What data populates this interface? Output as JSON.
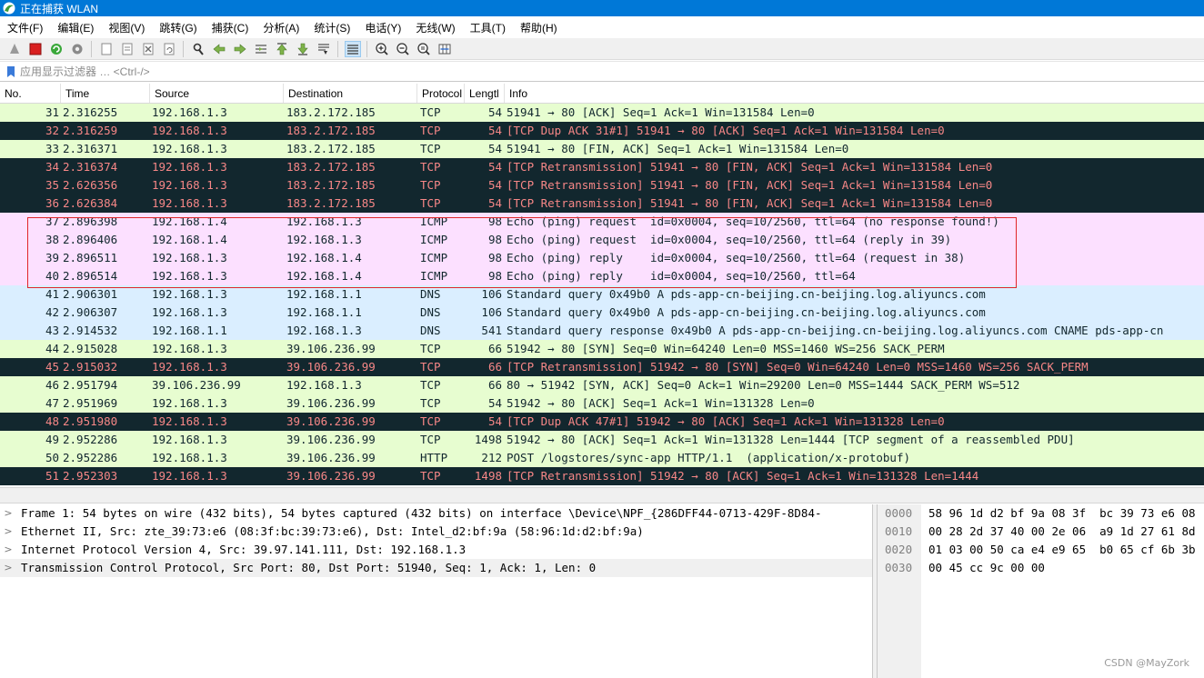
{
  "window": {
    "title": "正在捕获 WLAN"
  },
  "menu": [
    "文件(F)",
    "编辑(E)",
    "视图(V)",
    "跳转(G)",
    "捕获(C)",
    "分析(A)",
    "统计(S)",
    "电话(Y)",
    "无线(W)",
    "工具(T)",
    "帮助(H)"
  ],
  "toolbar_icons": [
    "start-capture-icon",
    "stop-capture-icon",
    "restart-capture-icon",
    "capture-options-icon",
    "open-file-icon",
    "save-file-icon",
    "close-file-icon",
    "reload-file-icon",
    "find-packet-icon",
    "go-back-icon",
    "go-forward-icon",
    "go-to-packet-icon",
    "go-first-icon",
    "go-last-icon",
    "auto-scroll-icon",
    "colorize-icon",
    "zoom-in-icon",
    "zoom-out-icon",
    "zoom-normal-icon",
    "resize-columns-icon"
  ],
  "filter": {
    "placeholder": "应用显示过滤器 … <Ctrl-/>"
  },
  "columns": {
    "no": "No.",
    "time": "Time",
    "source": "Source",
    "destination": "Destination",
    "protocol": "Protocol",
    "length": "Lengtl",
    "info": "Info"
  },
  "packets": [
    {
      "no": "31",
      "time": "2.316255",
      "src": "192.168.1.3",
      "dst": "183.2.172.185",
      "proto": "TCP",
      "len": "54",
      "info": "51941 → 80 [ACK] Seq=1 Ack=1 Win=131584 Len=0",
      "style": "tcp"
    },
    {
      "no": "32",
      "time": "2.316259",
      "src": "192.168.1.3",
      "dst": "183.2.172.185",
      "proto": "TCP",
      "len": "54",
      "info": "[TCP Dup ACK 31#1] 51941 → 80 [ACK] Seq=1 Ack=1 Win=131584 Len=0",
      "style": "bad"
    },
    {
      "no": "33",
      "time": "2.316371",
      "src": "192.168.1.3",
      "dst": "183.2.172.185",
      "proto": "TCP",
      "len": "54",
      "info": "51941 → 80 [FIN, ACK] Seq=1 Ack=1 Win=131584 Len=0",
      "style": "tcp"
    },
    {
      "no": "34",
      "time": "2.316374",
      "src": "192.168.1.3",
      "dst": "183.2.172.185",
      "proto": "TCP",
      "len": "54",
      "info": "[TCP Retransmission] 51941 → 80 [FIN, ACK] Seq=1 Ack=1 Win=131584 Len=0",
      "style": "bad"
    },
    {
      "no": "35",
      "time": "2.626356",
      "src": "192.168.1.3",
      "dst": "183.2.172.185",
      "proto": "TCP",
      "len": "54",
      "info": "[TCP Retransmission] 51941 → 80 [FIN, ACK] Seq=1 Ack=1 Win=131584 Len=0",
      "style": "bad"
    },
    {
      "no": "36",
      "time": "2.626384",
      "src": "192.168.1.3",
      "dst": "183.2.172.185",
      "proto": "TCP",
      "len": "54",
      "info": "[TCP Retransmission] 51941 → 80 [FIN, ACK] Seq=1 Ack=1 Win=131584 Len=0",
      "style": "bad"
    },
    {
      "no": "37",
      "time": "2.896398",
      "src": "192.168.1.4",
      "dst": "192.168.1.3",
      "proto": "ICMP",
      "len": "98",
      "info": "Echo (ping) request  id=0x0004, seq=10/2560, ttl=64 (no response found!)",
      "style": "icmp"
    },
    {
      "no": "38",
      "time": "2.896406",
      "src": "192.168.1.4",
      "dst": "192.168.1.3",
      "proto": "ICMP",
      "len": "98",
      "info": "Echo (ping) request  id=0x0004, seq=10/2560, ttl=64 (reply in 39)",
      "style": "icmp"
    },
    {
      "no": "39",
      "time": "2.896511",
      "src": "192.168.1.3",
      "dst": "192.168.1.4",
      "proto": "ICMP",
      "len": "98",
      "info": "Echo (ping) reply    id=0x0004, seq=10/2560, ttl=64 (request in 38)",
      "style": "icmp"
    },
    {
      "no": "40",
      "time": "2.896514",
      "src": "192.168.1.3",
      "dst": "192.168.1.4",
      "proto": "ICMP",
      "len": "98",
      "info": "Echo (ping) reply    id=0x0004, seq=10/2560, ttl=64",
      "style": "icmp"
    },
    {
      "no": "41",
      "time": "2.906301",
      "src": "192.168.1.3",
      "dst": "192.168.1.1",
      "proto": "DNS",
      "len": "106",
      "info": "Standard query 0x49b0 A pds-app-cn-beijing.cn-beijing.log.aliyuncs.com",
      "style": "dns"
    },
    {
      "no": "42",
      "time": "2.906307",
      "src": "192.168.1.3",
      "dst": "192.168.1.1",
      "proto": "DNS",
      "len": "106",
      "info": "Standard query 0x49b0 A pds-app-cn-beijing.cn-beijing.log.aliyuncs.com",
      "style": "dns"
    },
    {
      "no": "43",
      "time": "2.914532",
      "src": "192.168.1.1",
      "dst": "192.168.1.3",
      "proto": "DNS",
      "len": "541",
      "info": "Standard query response 0x49b0 A pds-app-cn-beijing.cn-beijing.log.aliyuncs.com CNAME pds-app-cn",
      "style": "dns"
    },
    {
      "no": "44",
      "time": "2.915028",
      "src": "192.168.1.3",
      "dst": "39.106.236.99",
      "proto": "TCP",
      "len": "66",
      "info": "51942 → 80 [SYN] Seq=0 Win=64240 Len=0 MSS=1460 WS=256 SACK_PERM",
      "style": "tcp"
    },
    {
      "no": "45",
      "time": "2.915032",
      "src": "192.168.1.3",
      "dst": "39.106.236.99",
      "proto": "TCP",
      "len": "66",
      "info": "[TCP Retransmission] 51942 → 80 [SYN] Seq=0 Win=64240 Len=0 MSS=1460 WS=256 SACK_PERM",
      "style": "bad"
    },
    {
      "no": "46",
      "time": "2.951794",
      "src": "39.106.236.99",
      "dst": "192.168.1.3",
      "proto": "TCP",
      "len": "66",
      "info": "80 → 51942 [SYN, ACK] Seq=0 Ack=1 Win=29200 Len=0 MSS=1444 SACK_PERM WS=512",
      "style": "tcp"
    },
    {
      "no": "47",
      "time": "2.951969",
      "src": "192.168.1.3",
      "dst": "39.106.236.99",
      "proto": "TCP",
      "len": "54",
      "info": "51942 → 80 [ACK] Seq=1 Ack=1 Win=131328 Len=0",
      "style": "tcp"
    },
    {
      "no": "48",
      "time": "2.951980",
      "src": "192.168.1.3",
      "dst": "39.106.236.99",
      "proto": "TCP",
      "len": "54",
      "info": "[TCP Dup ACK 47#1] 51942 → 80 [ACK] Seq=1 Ack=1 Win=131328 Len=0",
      "style": "bad"
    },
    {
      "no": "49",
      "time": "2.952286",
      "src": "192.168.1.3",
      "dst": "39.106.236.99",
      "proto": "TCP",
      "len": "1498",
      "info": "51942 → 80 [ACK] Seq=1 Ack=1 Win=131328 Len=1444 [TCP segment of a reassembled PDU]",
      "style": "tcp"
    },
    {
      "no": "50",
      "time": "2.952286",
      "src": "192.168.1.3",
      "dst": "39.106.236.99",
      "proto": "HTTP",
      "len": "212",
      "info": "POST /logstores/sync-app HTTP/1.1  (application/x-protobuf)",
      "style": "tcp"
    },
    {
      "no": "51",
      "time": "2.952303",
      "src": "192.168.1.3",
      "dst": "39.106.236.99",
      "proto": "TCP",
      "len": "1498",
      "info": "[TCP Retransmission] 51942 → 80 [ACK] Seq=1 Ack=1 Win=131328 Len=1444",
      "style": "bad"
    }
  ],
  "details": [
    "Frame 1: 54 bytes on wire (432 bits), 54 bytes captured (432 bits) on interface \\Device\\NPF_{286DFF44-0713-429F-8D84-",
    "Ethernet II, Src: zte_39:73:e6 (08:3f:bc:39:73:e6), Dst: Intel_d2:bf:9a (58:96:1d:d2:bf:9a)",
    "Internet Protocol Version 4, Src: 39.97.141.111, Dst: 192.168.1.3",
    "Transmission Control Protocol, Src Port: 80, Dst Port: 51940, Seq: 1, Ack: 1, Len: 0"
  ],
  "bytes": {
    "offsets": [
      "0000",
      "0010",
      "0020",
      "0030"
    ],
    "hex": [
      "58 96 1d d2 bf 9a 08 3f  bc 39 73 e6 08",
      "00 28 2d 37 40 00 2e 06  a9 1d 27 61 8d",
      "01 03 00 50 ca e4 e9 65  b0 65 cf 6b 3b",
      "00 45 cc 9c 00 00"
    ]
  },
  "watermark": "CSDN @MayZork",
  "colors": {
    "tcp_bg": "#e7fdd0",
    "bad_bg": "#12272e",
    "bad_fg": "#f78787",
    "icmp_bg": "#fce0ff",
    "dns_bg": "#daeeff",
    "highlight_box": "#e0262a",
    "titlebar": "#0078d7"
  }
}
